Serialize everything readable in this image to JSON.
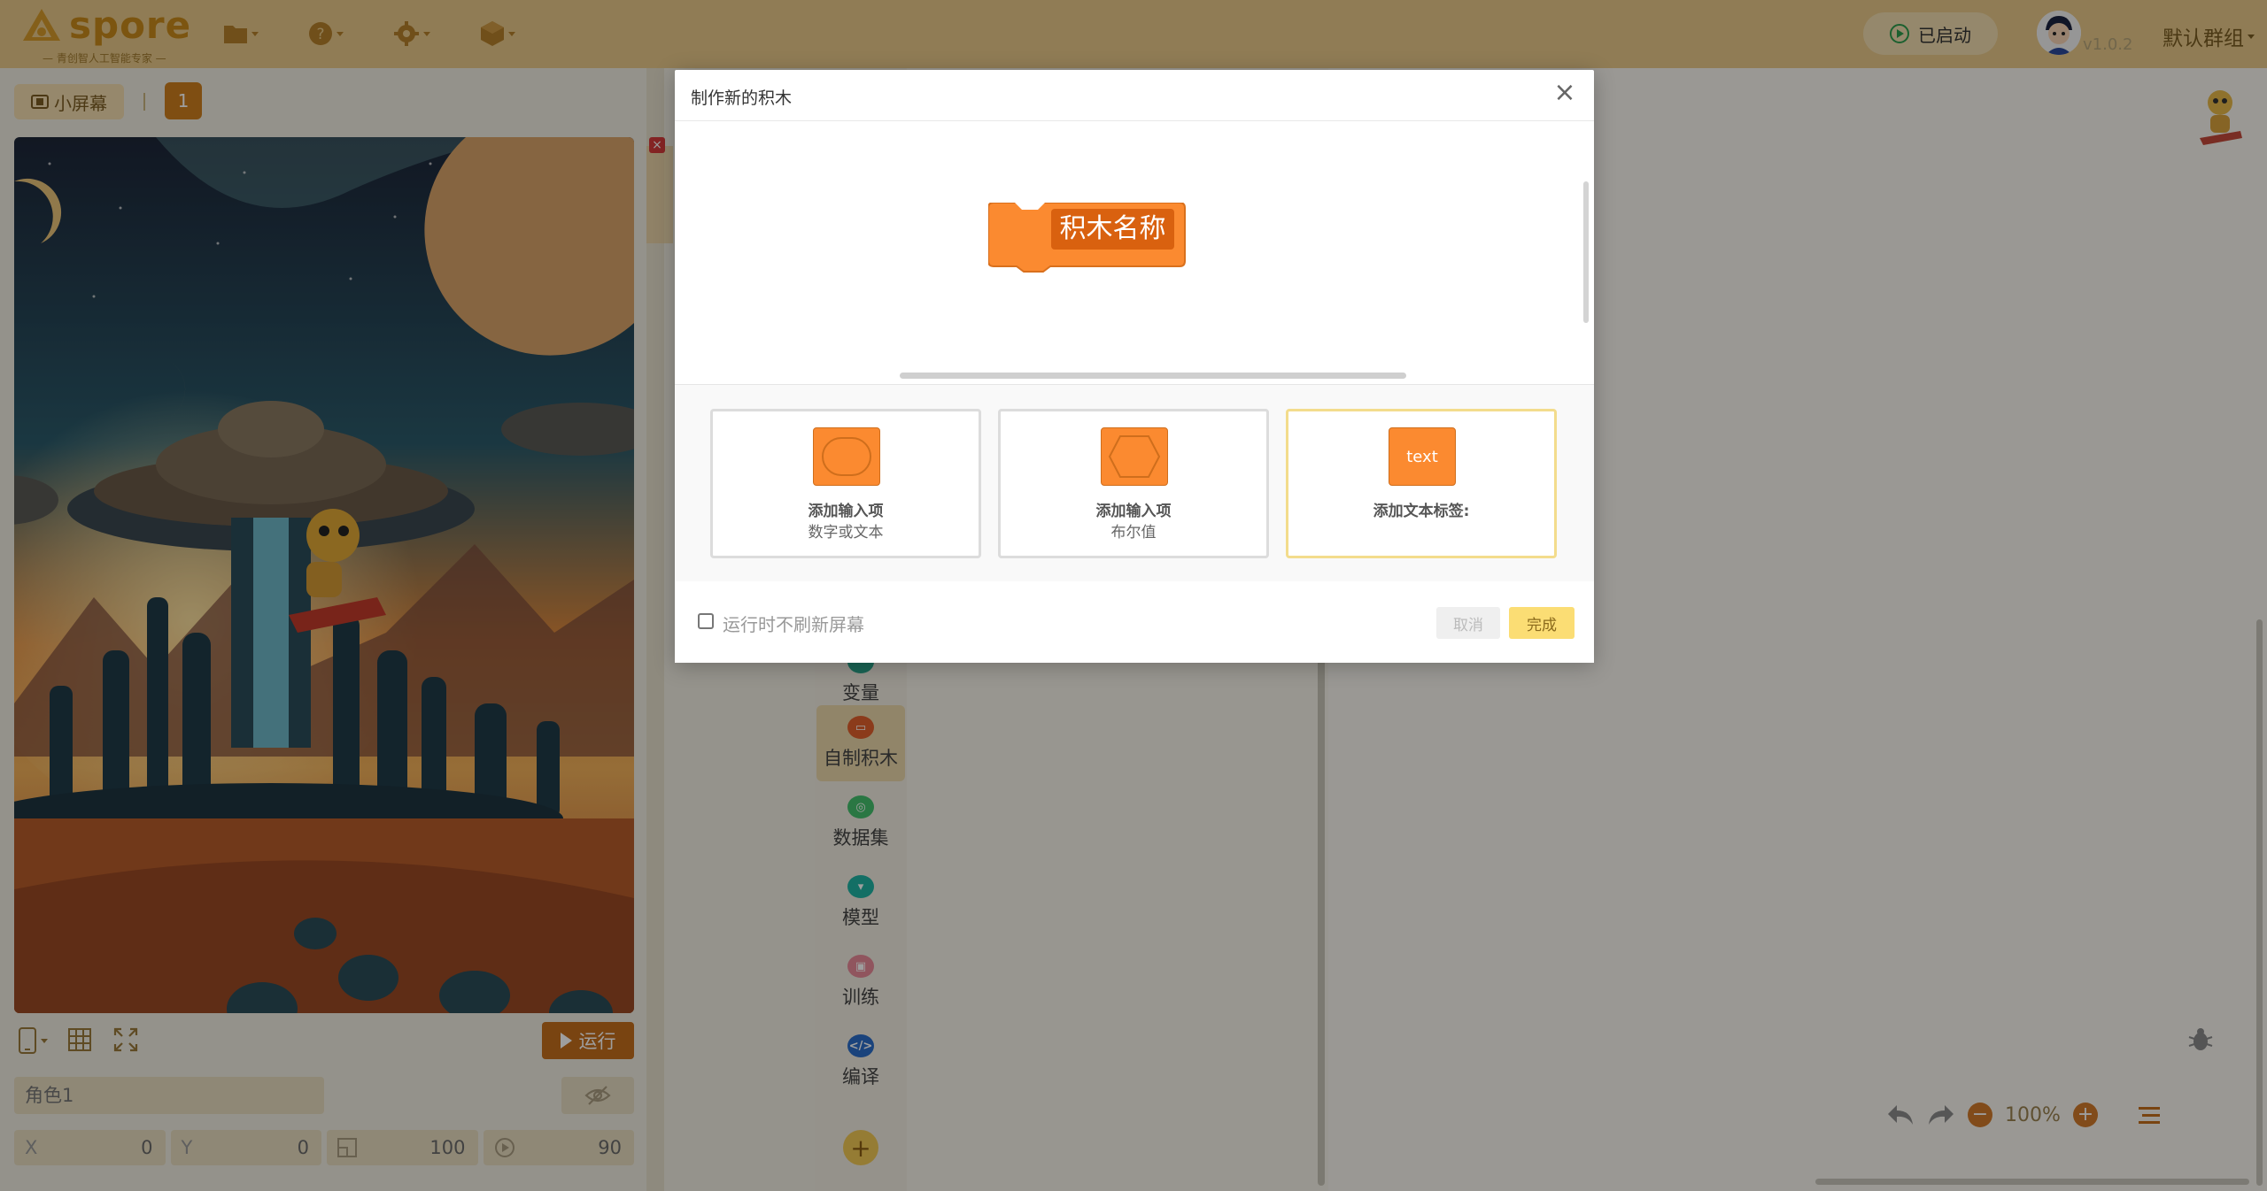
{
  "app": {
    "logo_text": "spore",
    "logo_slogan": "— 青创智人工智能专家 —",
    "status_label": "已启动",
    "version": "v1.0.2",
    "group_menu": "默认群组"
  },
  "stage": {
    "small_screen_label": "小屏幕",
    "page_number": "1",
    "run_label": "运行",
    "sprite_name": "角色1",
    "x_label": "X",
    "x_value": "0",
    "y_label": "Y",
    "y_value": "0",
    "size_value": "100",
    "direction_value": "90"
  },
  "palette": {
    "categories": [
      {
        "label": "变量",
        "color": "#2aa38a",
        "icon": "variables-icon"
      },
      {
        "label": "自制积木",
        "color": "#e0602c",
        "icon": "my-blocks-icon"
      },
      {
        "label": "数据集",
        "color": "#44c06c",
        "icon": "dataset-icon"
      },
      {
        "label": "模型",
        "color": "#1fb4a4",
        "icon": "model-icon"
      },
      {
        "label": "训练",
        "color": "#e88a98",
        "icon": "train-icon"
      },
      {
        "label": "编译",
        "color": "#2b6cc8",
        "icon": "compile-icon"
      }
    ],
    "add_extension": "+"
  },
  "workspace": {
    "zoom_level": "100%"
  },
  "modal": {
    "title": "制作新的积木",
    "block_label": "积木名称",
    "options": [
      {
        "title": "添加输入项",
        "subtitle": "数字或文本",
        "shape": "oval"
      },
      {
        "title": "添加输入项",
        "subtitle": "布尔值",
        "shape": "diamond"
      },
      {
        "title": "添加文本标签:",
        "subtitle": "",
        "shape": "text",
        "shape_text": "text"
      }
    ],
    "checkbox_label": "运行时不刷新屏幕",
    "checkbox_checked": false,
    "cancel_label": "取消",
    "done_label": "完成"
  },
  "colors": {
    "topbar": "#e8c98a",
    "accent_orange": "#fb8a30",
    "run_button": "#c36e1c",
    "done_button": "#fbdd74"
  }
}
